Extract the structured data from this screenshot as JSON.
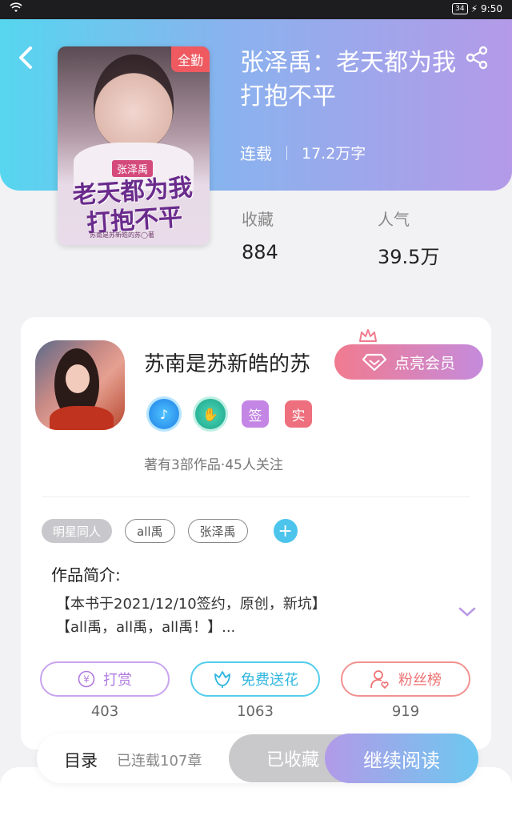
{
  "status_bar": {
    "battery": "34",
    "time": "9:50"
  },
  "book": {
    "cover_badge": "全勤",
    "cover_name_tag": "张泽禹",
    "cover_title_line1": "老天都为我",
    "cover_title_line2": "打抱不平",
    "cover_author_text": "苏南是苏新皓的苏◯著",
    "title": "张泽禹：老天都为我打抱不平",
    "status": "连载",
    "word_count": "17.2万字",
    "stats": [
      {
        "label": "收藏",
        "value": "884"
      },
      {
        "label": "人气",
        "value": "39.5万"
      }
    ]
  },
  "author": {
    "name": "苏南是苏新皓的苏",
    "vip_label": "点亮会员",
    "badge_sign": "签",
    "badge_real": "实",
    "meta": "著有3部作品·45人关注"
  },
  "tags": [
    "明星同人",
    "all禹",
    "张泽禹"
  ],
  "intro": {
    "title": "作品简介:",
    "line1": "【本书于2021/12/10签约，原创，新坑】",
    "line2": "【all禹，all禹，all禹！】..."
  },
  "actions": [
    {
      "label": "打赏",
      "count": "403"
    },
    {
      "label": "免费送花",
      "count": "1063"
    },
    {
      "label": "粉丝榜",
      "count": "919"
    }
  ],
  "bottom": {
    "toc": "目录",
    "chapters": "已连载107章",
    "saved": "已收藏",
    "read": "继续阅读"
  },
  "colors": {
    "header_start": "#56d6ef",
    "header_end": "#b49ae8",
    "accent_pink": "#ee6f7d",
    "accent_blue": "#4cc4ec"
  }
}
